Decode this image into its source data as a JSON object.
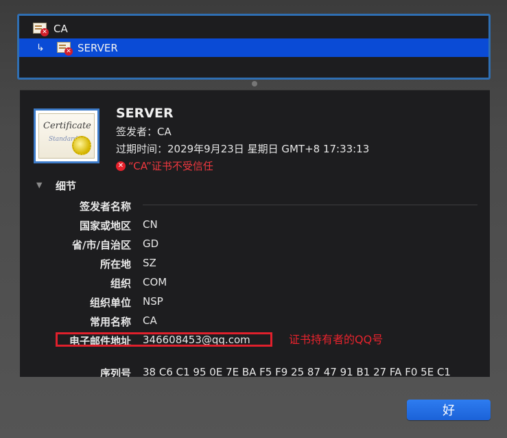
{
  "chain": {
    "items": [
      {
        "label": "CA",
        "arrow": ""
      },
      {
        "label": "SERVER",
        "arrow": "↳"
      }
    ]
  },
  "certificate": {
    "image_text": "Certificate",
    "image_subtext": "Standard",
    "name": "SERVER",
    "issuer_line": "签发者：CA",
    "expiry_line": "过期时间：2029年9月23日 星期日 GMT+8 17:33:13",
    "trust_warning": "“CA”证书不受信任",
    "error_icon_glyph": "✕"
  },
  "details": {
    "toggle_glyph": "▼",
    "section_label": "细节",
    "group_label": "签发者名称",
    "fields": [
      {
        "label": "国家或地区",
        "value": "CN"
      },
      {
        "label": "省/市/自治区",
        "value": "GD"
      },
      {
        "label": "所在地",
        "value": "SZ"
      },
      {
        "label": "组织",
        "value": "COM"
      },
      {
        "label": "组织单位",
        "value": "NSP"
      },
      {
        "label": "常用名称",
        "value": "CA"
      },
      {
        "label": "电子邮件地址",
        "value": "346608453@qq.com"
      },
      {
        "label": "序列号",
        "value": "38 C6 C1 95 0E 7E BA F5 F9 25 87 47 91 B1 27 FA F0 5E C1"
      }
    ],
    "annotation": "证书持有者的QQ号"
  },
  "buttons": {
    "ok_label": "好"
  },
  "colors": {
    "selection": "#0a4bd6",
    "focus_ring": "#2f6fb3",
    "warning_red": "#f0383f",
    "annotation_red": "#e8232d",
    "button_blue": "#1b62d8"
  }
}
